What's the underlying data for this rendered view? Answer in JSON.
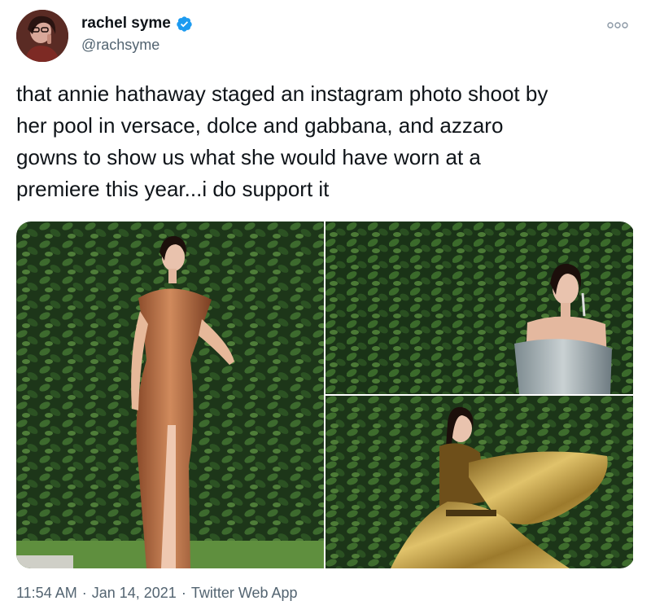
{
  "user": {
    "display_name": "rachel syme",
    "handle": "@rachsyme",
    "verified_icon": "verified-badge-icon",
    "avatar_icon": "avatar"
  },
  "tweet": {
    "text": "that annie hathaway staged an instagram photo shoot by\nher pool in versace, dolce and gabbana, and azzaro\ngowns to show us what she would have worn at a\npremiere this year...i do support it"
  },
  "media": {
    "count": 3,
    "photos": [
      {
        "name": "photo-copper-gown"
      },
      {
        "name": "photo-silver-gown"
      },
      {
        "name": "photo-gold-gown"
      }
    ]
  },
  "meta": {
    "time": "11:54 AM",
    "separator": "·",
    "date": "Jan 14, 2021",
    "source": "Twitter Web App"
  },
  "colors": {
    "text": "#0f1419",
    "secondary": "#536471",
    "verified": "#1d9bf0",
    "hedge": "#1f3a1c"
  }
}
